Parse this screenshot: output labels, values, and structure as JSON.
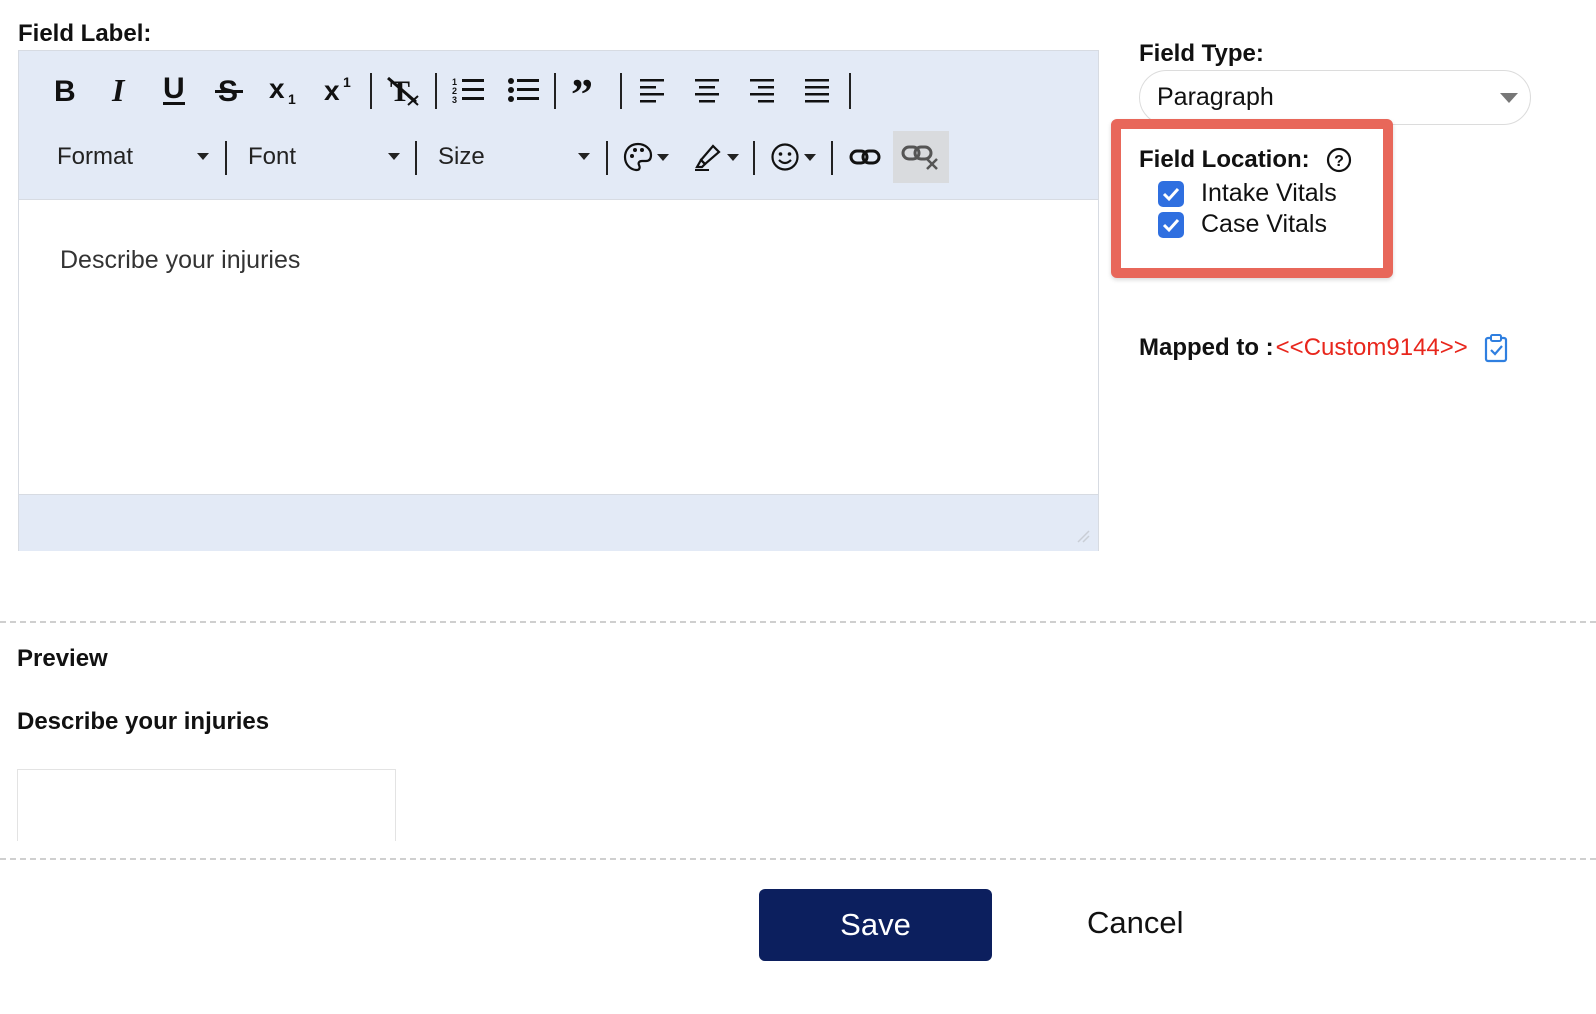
{
  "field_label": {
    "title": "Field Label:"
  },
  "toolbar": {
    "row1": [
      "bold-icon",
      "italic-icon",
      "underline-icon",
      "strikethrough-icon",
      "subscript-icon",
      "superscript-icon",
      "remove-format-icon",
      "numbered-list-icon",
      "bulleted-list-icon",
      "blockquote-icon",
      "align-left-icon",
      "align-center-icon",
      "align-right-icon",
      "align-justify-icon"
    ],
    "format_label": "Format",
    "font_label": "Font",
    "size_label": "Size",
    "row2_icons": [
      "text-color-icon",
      "highlight-icon",
      "emoji-icon",
      "link-icon",
      "unlink-icon"
    ]
  },
  "editor": {
    "content": "Describe your injuries"
  },
  "field_type": {
    "title": "Field Type:",
    "value": "Paragraph"
  },
  "field_location": {
    "title": "Field Location:",
    "options": [
      {
        "label": "Intake Vitals",
        "checked": true
      },
      {
        "label": "Case Vitals",
        "checked": true
      }
    ],
    "highlight_color": "#e8675a"
  },
  "mapped": {
    "label": "Mapped to :",
    "value": "<<Custom9144>>",
    "value_color": "#e8261c"
  },
  "preview": {
    "title": "Preview",
    "field_label": "Describe your injuries"
  },
  "actions": {
    "save": "Save",
    "cancel": "Cancel",
    "save_color": "#0c1f5e"
  },
  "colors": {
    "toolbar_bg": "#e3eaf6",
    "checkbox": "#2f6fe0"
  }
}
